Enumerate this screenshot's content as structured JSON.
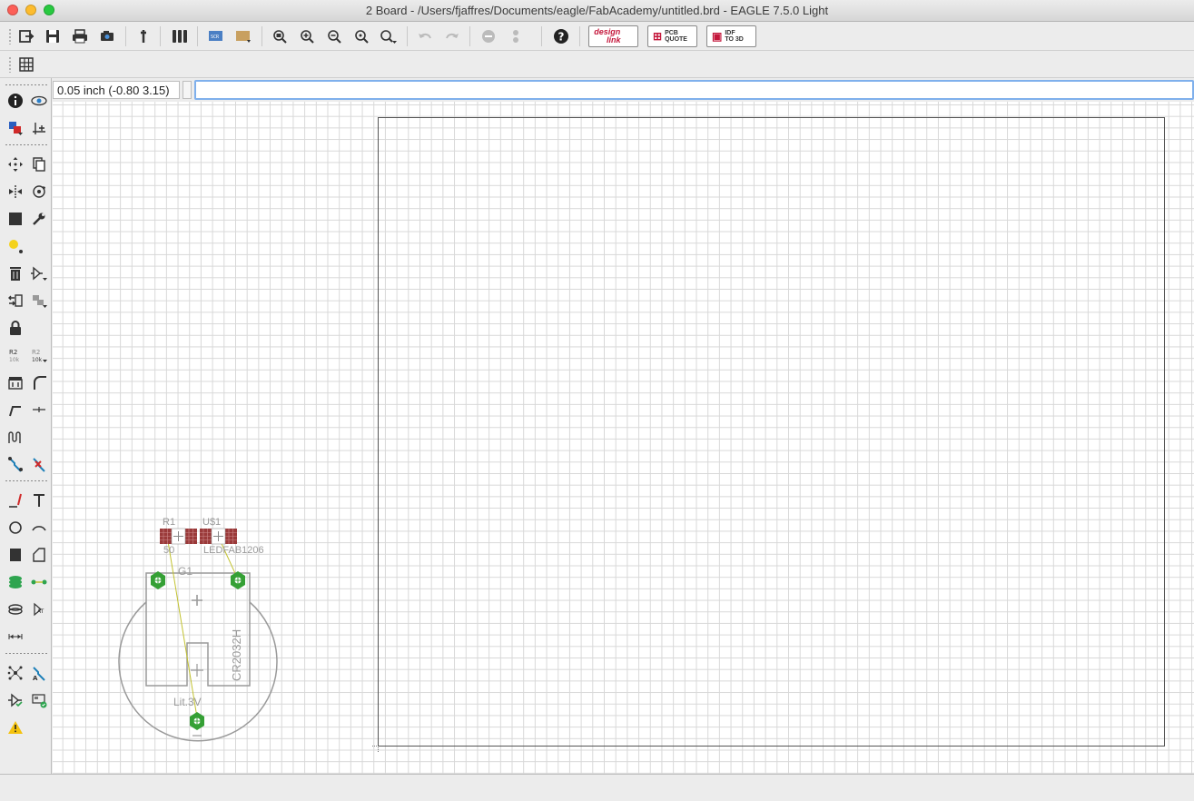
{
  "window": {
    "title": "2 Board - /Users/fjaffres/Documents/eagle/FabAcademy/untitled.brd - EAGLE 7.5.0 Light"
  },
  "toolbar": {
    "buttons": [
      "open-icon",
      "save-icon",
      "print-icon",
      "cam-icon",
      "switch-schematic-icon",
      "layer-settings-icon",
      "script-icon",
      "run-ulp-icon",
      "zoom-fit-icon",
      "zoom-in-icon",
      "zoom-out-icon",
      "zoom-redraw-icon",
      "zoom-select-icon",
      "undo-icon",
      "redo-icon",
      "stop-icon",
      "go-icon",
      "help-icon"
    ],
    "brand": {
      "design_link_top": "design",
      "design_link_bottom": "link",
      "pcb_quote_top": "PCB",
      "pcb_quote_bottom": "QUOTE",
      "idf_top": "IDF",
      "idf_bottom": "TO 3D"
    }
  },
  "commandline": {
    "coordinates": "0.05 inch (-0.80 3.15)",
    "value": ""
  },
  "board": {
    "parts": {
      "r1_name": "R1",
      "r1_value": "50",
      "u1_name": "U$1",
      "u1_value": "LEDFAB1206",
      "g1_name": "G1",
      "g1_package": "CR2032H",
      "g1_value": "Lit.3V"
    },
    "colors": {
      "pad": "#35a035",
      "smd": "#9a3a3a",
      "airwire": "#c2c230",
      "outline": "#555555"
    }
  }
}
